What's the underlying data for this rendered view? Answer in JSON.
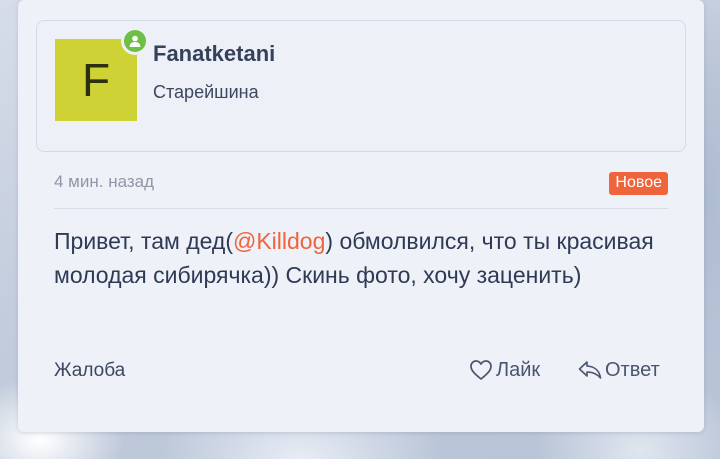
{
  "author": {
    "avatar_letter": "F",
    "avatar_color": "#cfd234",
    "username": "Fanatketani",
    "title": "Старейшина",
    "online_icon": "person-online-icon",
    "online_color": "#6dbf45"
  },
  "post": {
    "timestamp": "4 мин. назад",
    "badge": "Новое",
    "badge_color": "#f0643c",
    "message": {
      "before": "Привет, там дед(",
      "mention": "@Killdog",
      "after": ") обмолвился, что ты красивая молодая сибирячка)) Скинь фото, хочу заценить)"
    }
  },
  "actions": {
    "report": "Жалоба",
    "like": "Лайк",
    "like_icon": "heart-icon",
    "reply": "Ответ",
    "reply_icon": "reply-arrow-icon"
  }
}
